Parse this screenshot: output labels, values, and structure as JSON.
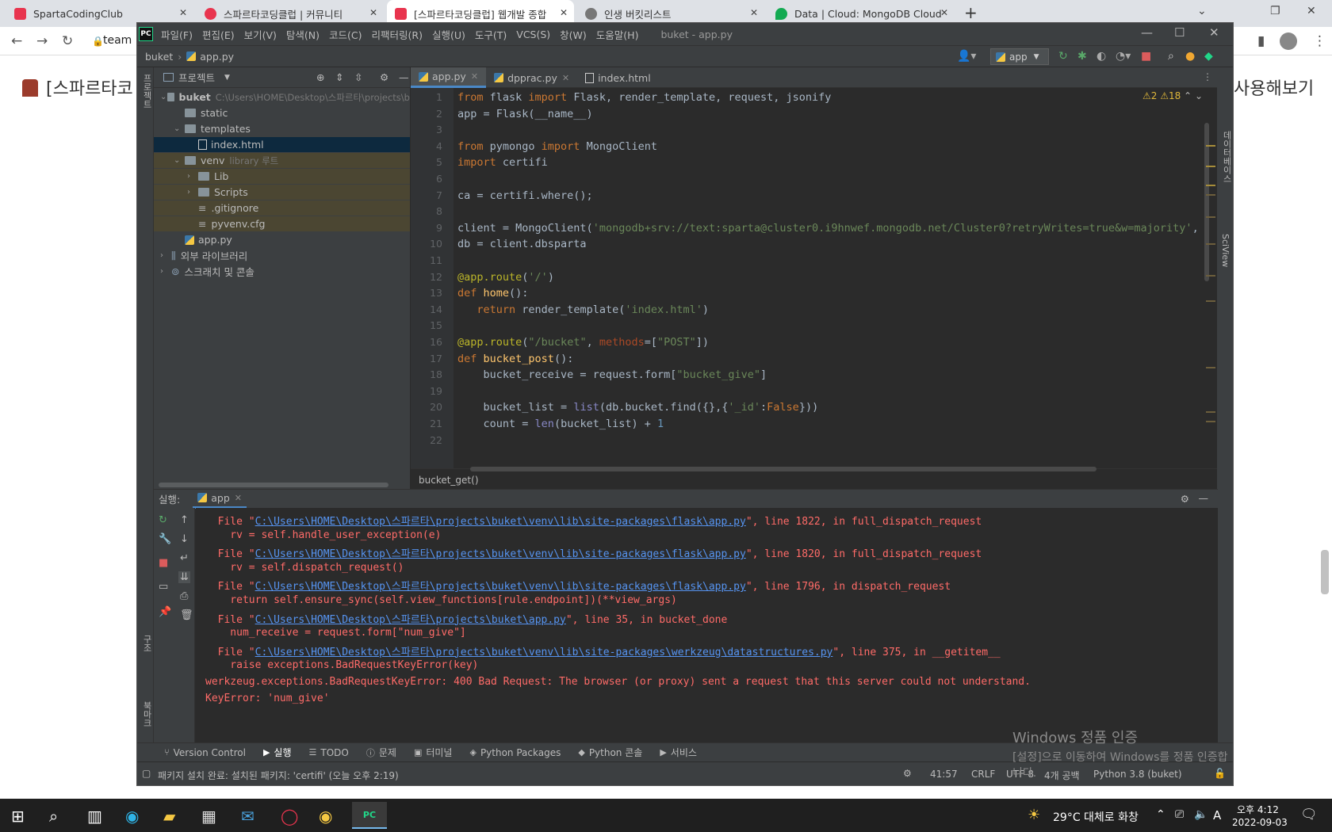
{
  "browser": {
    "tabs": [
      {
        "title": "SpartaCodingClub",
        "color": "#e8344e"
      },
      {
        "title": "스파르타코딩클럽 | 커뮤니티",
        "color": "#e8344e"
      },
      {
        "title": "[스파르타코딩클럽] 웹개발 종합",
        "color": "#e8344e"
      },
      {
        "title": "인생 버킷리스트",
        "color": "#666666"
      },
      {
        "title": "Data | Cloud: MongoDB Cloud",
        "color": "#13aa52"
      }
    ],
    "address": "team",
    "page_heading": "[스파르타코",
    "page_right": "사용해보기"
  },
  "ide": {
    "menu": [
      "파일(F)",
      "편집(E)",
      "보기(V)",
      "탐색(N)",
      "코드(C)",
      "리팩터링(R)",
      "실행(U)",
      "도구(T)",
      "VCS(S)",
      "창(W)",
      "도움말(H)"
    ],
    "window_title": "buket - app.py",
    "breadcrumb_project": "buket",
    "breadcrumb_file": "app.py",
    "run_config": "app",
    "left_strip_label": "프로젝트",
    "right_strip_label1": "데이터베이스",
    "right_strip_label2": "SciView",
    "project_header": "프로젝트",
    "tree": [
      {
        "label": "buket",
        "extra": "C:\\Users\\HOME\\Desktop\\스파르타\\projects\\b",
        "indent": 0,
        "type": "folder-open",
        "bold": true
      },
      {
        "label": "static",
        "extra": "",
        "indent": 1,
        "type": "folder"
      },
      {
        "label": "templates",
        "extra": "",
        "indent": 1,
        "type": "folder-open"
      },
      {
        "label": "index.html",
        "extra": "",
        "indent": 2,
        "type": "html",
        "selected": true
      },
      {
        "label": "venv",
        "extra": "library 루트",
        "indent": 1,
        "type": "folder-open",
        "venv": true
      },
      {
        "label": "Lib",
        "extra": "",
        "indent": 2,
        "type": "folder-closed",
        "venv": true
      },
      {
        "label": "Scripts",
        "extra": "",
        "indent": 2,
        "type": "folder-closed",
        "venv": true
      },
      {
        "label": ".gitignore",
        "extra": "",
        "indent": 2,
        "type": "file",
        "venv": true
      },
      {
        "label": "pyvenv.cfg",
        "extra": "",
        "indent": 2,
        "type": "file",
        "venv": true
      },
      {
        "label": "app.py",
        "extra": "",
        "indent": 1,
        "type": "py"
      },
      {
        "label": "외부 라이브러리",
        "extra": "",
        "indent": 0,
        "type": "lib"
      },
      {
        "label": "스크래치 및 콘솔",
        "extra": "",
        "indent": 0,
        "type": "scratch"
      }
    ],
    "editor_tabs": [
      {
        "label": "app.py",
        "type": "py",
        "active": true
      },
      {
        "label": "dpprac.py",
        "type": "py"
      },
      {
        "label": "index.html",
        "type": "html"
      }
    ],
    "inspections": "⚠2  ⚠18",
    "breadcrumb_function": "bucket_get()",
    "code_lines": [
      "from flask import Flask, render_template, request, jsonify",
      "app = Flask(__name__)",
      "",
      "from pymongo import MongoClient",
      "import certifi",
      "",
      "ca = certifi.where();",
      "",
      "client = MongoClient('mongodb+srv://text:sparta@cluster0.i9hnwef.mongodb.net/Cluster0?retryWrites=true&w=majority',",
      "db = client.dbsparta",
      "",
      "@app.route('/')",
      "def home():",
      "   return render_template('index.html')",
      "",
      "@app.route(\"/bucket\", methods=[\"POST\"])",
      "def bucket_post():",
      "    bucket_receive = request.form[\"bucket_give\"]",
      "",
      "    bucket_list = list(db.bucket.find({},{'_id':False}))",
      "    count = len(bucket_list) + 1",
      ""
    ],
    "run_label": "실행:",
    "run_tab": "app",
    "console_lines": [
      {
        "pre": "  File \"",
        "link": "C:\\Users\\HOME\\Desktop\\스파르타\\projects\\buket\\venv\\lib\\site-packages\\flask\\app.py",
        "post": "\", line 1822, in full_dispatch_request"
      },
      {
        "pre": "    rv = self.handle_user_exception(e)",
        "link": "",
        "post": ""
      },
      {
        "pre": "  File \"",
        "link": "C:\\Users\\HOME\\Desktop\\스파르타\\projects\\buket\\venv\\lib\\site-packages\\flask\\app.py",
        "post": "\", line 1820, in full_dispatch_request"
      },
      {
        "pre": "    rv = self.dispatch_request()",
        "link": "",
        "post": ""
      },
      {
        "pre": "  File \"",
        "link": "C:\\Users\\HOME\\Desktop\\스파르타\\projects\\buket\\venv\\lib\\site-packages\\flask\\app.py",
        "post": "\", line 1796, in dispatch_request"
      },
      {
        "pre": "    return self.ensure_sync(self.view_functions[rule.endpoint])(**view_args)",
        "link": "",
        "post": ""
      },
      {
        "pre": "  File \"",
        "link": "C:\\Users\\HOME\\Desktop\\스파르타\\projects\\buket\\app.py",
        "post": "\", line 35, in bucket_done"
      },
      {
        "pre": "    num_receive = request.form[\"num_give\"]",
        "link": "",
        "post": ""
      },
      {
        "pre": "  File \"",
        "link": "C:\\Users\\HOME\\Desktop\\스파르타\\projects\\buket\\venv\\lib\\site-packages\\werkzeug\\datastructures.py",
        "post": "\", line 375, in __getitem__"
      },
      {
        "pre": "    raise exceptions.BadRequestKeyError(key)",
        "link": "",
        "post": ""
      },
      {
        "pre": "werkzeug.exceptions.BadRequestKeyError: 400 Bad Request: The browser (or proxy) sent a request that this server could not understand.",
        "link": "",
        "post": ""
      },
      {
        "pre": "KeyError: 'num_give'",
        "link": "",
        "post": ""
      }
    ],
    "left_strip_label3": "구조",
    "left_strip_label4": "북마크",
    "tool_windows": [
      "Version Control",
      "실행",
      "TODO",
      "문제",
      "터미널",
      "Python Packages",
      "Python 콘솔",
      "서비스"
    ],
    "status_message": "패키지 설치 완료: 설치된 패키지: 'certifi' (오늘 오후 2:19)",
    "status_right": [
      "41:57",
      "CRLF",
      "UTF-8",
      "4개 공백",
      "Python 3.8 (buket)"
    ],
    "watermark_title": "Windows 정품 인증",
    "watermark_sub": "[설정]으로 이동하여 Windows를 정품 인증합니다."
  },
  "taskbar": {
    "weather": "29°C  대체로 화창",
    "ime": "A",
    "time": "오후 4:12",
    "date": "2022-09-03"
  }
}
